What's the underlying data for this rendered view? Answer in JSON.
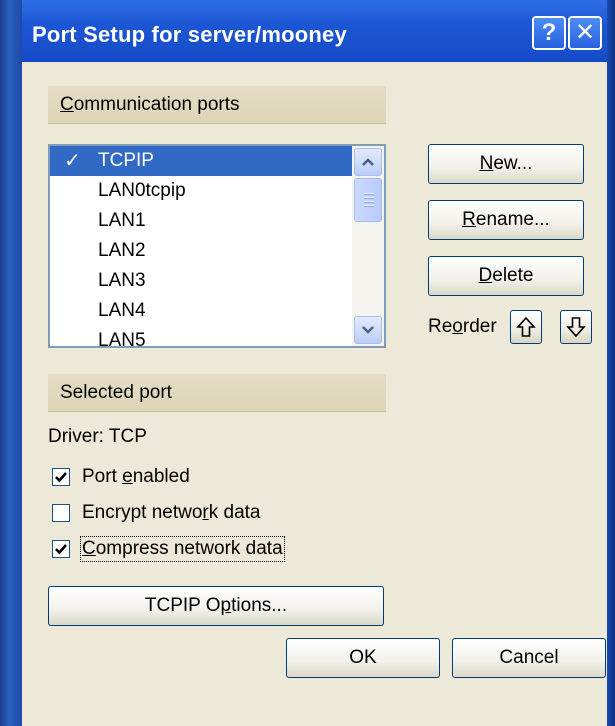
{
  "window": {
    "title": "Port Setup for server/mooney",
    "help_label": "?",
    "close_label": "✕"
  },
  "communication_ports": {
    "header": "Communication ports",
    "items": [
      {
        "label": "TCPIP",
        "selected": true,
        "checked_mark": "✓"
      },
      {
        "label": "LAN0tcpip"
      },
      {
        "label": "LAN1"
      },
      {
        "label": "LAN2"
      },
      {
        "label": "LAN3"
      },
      {
        "label": "LAN4"
      },
      {
        "label": "LAN5"
      }
    ]
  },
  "buttons": {
    "new": "New...",
    "rename": "Rename...",
    "delete": "Delete",
    "reorder_label": "Reorder",
    "tcpip_options": "TCPIP Options...",
    "ok": "OK",
    "cancel": "Cancel"
  },
  "selected_port": {
    "header": "Selected port",
    "driver": "Driver: TCP",
    "options": [
      {
        "label": "Port enabled",
        "checked": true
      },
      {
        "label": "Encrypt network data",
        "checked": false
      },
      {
        "label": "Compress network data",
        "checked": true
      }
    ]
  },
  "colors": {
    "selection": "#316ac5",
    "titlebar": "#1d56d4",
    "dialog_face": "#ece9d8"
  }
}
